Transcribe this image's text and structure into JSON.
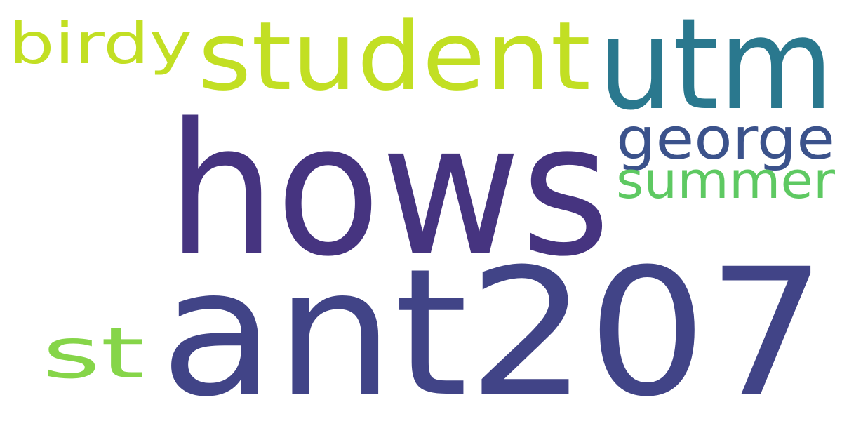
{
  "words": [
    {
      "text": "hows",
      "color": "#463480"
    },
    {
      "text": "ant207",
      "color": "#414487"
    },
    {
      "text": "utm",
      "color": "#2A788E"
    },
    {
      "text": "student",
      "color": "#C2DF23"
    },
    {
      "text": "birdy",
      "color": "#C2DF23"
    },
    {
      "text": "george",
      "color": "#3B528B"
    },
    {
      "text": "summer",
      "color": "#5EC962"
    },
    {
      "text": "st",
      "color": "#86D549"
    }
  ]
}
